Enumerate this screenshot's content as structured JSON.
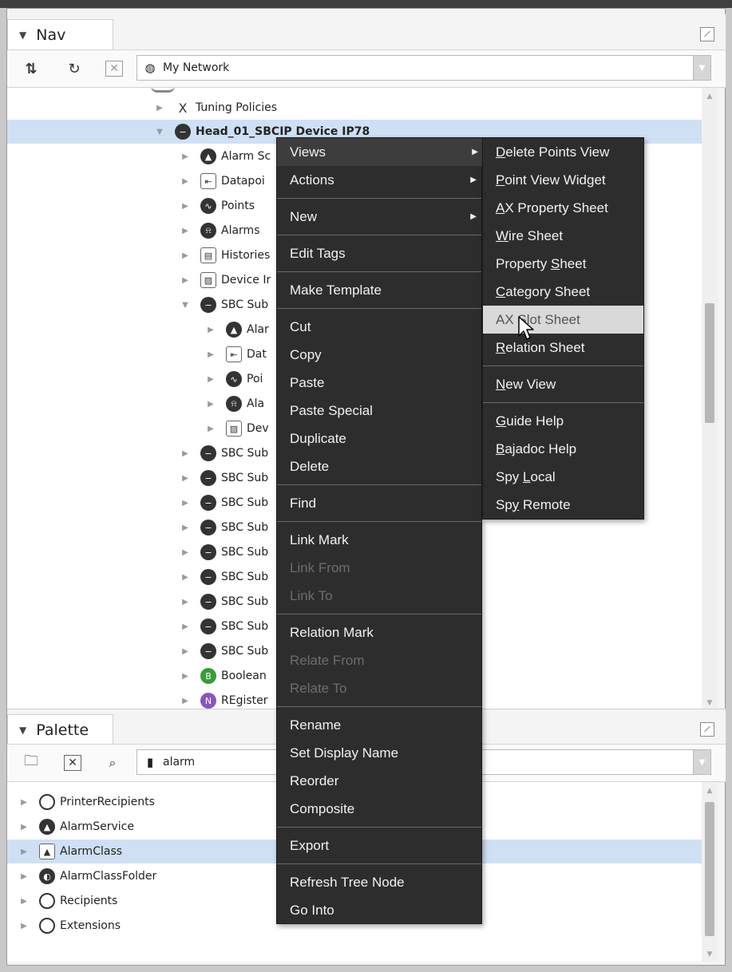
{
  "nav": {
    "title": "Nav",
    "combo_value": "My Network",
    "tree": [
      {
        "label": "Tuning Policies",
        "icon": "tuning-icon",
        "glyph": "X"
      },
      {
        "label": "Head_01_SBCIP Device  IP78",
        "icon": "device-icon",
        "glyph": "−",
        "selected": true,
        "bold": true
      },
      {
        "label": "Alarm Sc",
        "icon": "alarm-source-icon",
        "glyph": "▲"
      },
      {
        "label": "Datapoi",
        "icon": "datapoint-icon",
        "glyph": "⇤"
      },
      {
        "label": "Points",
        "icon": "points-icon",
        "glyph": "∿"
      },
      {
        "label": "Alarms",
        "icon": "alarm-bell-icon",
        "glyph": "⍾"
      },
      {
        "label": "Histories",
        "icon": "histories-icon",
        "glyph": "▤"
      },
      {
        "label": "Device Ir",
        "icon": "device-info-icon",
        "glyph": "▨"
      },
      {
        "label": "SBC Sub",
        "icon": "sbc-sub-icon",
        "glyph": "−"
      },
      {
        "label": "Alar",
        "icon": "alarm-source-icon",
        "glyph": "▲"
      },
      {
        "label": "Dat",
        "icon": "datapoint-icon",
        "glyph": "⇤"
      },
      {
        "label": "Poi",
        "icon": "points-icon",
        "glyph": "∿"
      },
      {
        "label": "Ala",
        "icon": "alarm-bell-icon",
        "glyph": "⍾"
      },
      {
        "label": "Dev",
        "icon": "device-info-icon",
        "glyph": "▨"
      },
      {
        "label": "SBC Sub",
        "icon": "sbc-sub-icon",
        "glyph": "−"
      },
      {
        "label": "SBC Sub",
        "icon": "sbc-sub-icon",
        "glyph": "−"
      },
      {
        "label": "SBC Sub",
        "icon": "sbc-sub-icon",
        "glyph": "−"
      },
      {
        "label": "SBC Sub",
        "icon": "sbc-sub-icon",
        "glyph": "−"
      },
      {
        "label": "SBC Sub",
        "icon": "sbc-sub-icon",
        "glyph": "−"
      },
      {
        "label": "SBC Sub",
        "icon": "sbc-sub-icon",
        "glyph": "−"
      },
      {
        "label": "SBC Sub",
        "icon": "sbc-sub-icon",
        "glyph": "−"
      },
      {
        "label": "SBC Sub",
        "icon": "sbc-sub-icon",
        "glyph": "−"
      },
      {
        "label": "SBC Sub",
        "icon": "sbc-sub-icon",
        "glyph": "−"
      },
      {
        "label": "Boolean",
        "icon": "boolean-icon",
        "glyph": "B"
      },
      {
        "label": "REgister",
        "icon": "numeric-icon",
        "glyph": "N"
      }
    ]
  },
  "palette": {
    "title": "Palette",
    "combo_value": "alarm",
    "tree": [
      {
        "label": "PrinterRecipients",
        "icon": "recipient-icon"
      },
      {
        "label": "AlarmService",
        "icon": "alarm-service-icon"
      },
      {
        "label": "AlarmClass",
        "icon": "alarm-class-icon",
        "selected": true
      },
      {
        "label": "AlarmClassFolder",
        "icon": "alarm-class-folder-icon"
      },
      {
        "label": "Recipients",
        "icon": "recipient-icon"
      },
      {
        "label": "Extensions",
        "icon": "extension-icon"
      }
    ]
  },
  "context_menu": {
    "items": [
      {
        "label": "Views",
        "submenu": true,
        "highlighted": true
      },
      {
        "label": "Actions",
        "submenu": true
      },
      {
        "label": "New",
        "submenu": true
      },
      {
        "label": "Edit Tags"
      },
      {
        "label": "Make Template"
      },
      {
        "label": "Cut"
      },
      {
        "label": "Copy"
      },
      {
        "label": "Paste"
      },
      {
        "label": "Paste Special"
      },
      {
        "label": "Duplicate"
      },
      {
        "label": "Delete"
      },
      {
        "label": "Find"
      },
      {
        "label": "Link Mark"
      },
      {
        "label": "Link From",
        "disabled": true
      },
      {
        "label": "Link To",
        "disabled": true
      },
      {
        "label": "Relation Mark"
      },
      {
        "label": "Relate From",
        "disabled": true
      },
      {
        "label": "Relate To",
        "disabled": true
      },
      {
        "label": "Rename"
      },
      {
        "label": "Set Display Name"
      },
      {
        "label": "Reorder"
      },
      {
        "label": "Composite"
      },
      {
        "label": "Export"
      },
      {
        "label": "Refresh Tree Node"
      },
      {
        "label": "Go Into"
      }
    ]
  },
  "views_submenu": {
    "items": [
      {
        "label": "Delete Points View",
        "mnemonic": "D"
      },
      {
        "label": "Point View Widget",
        "mnemonic": "P"
      },
      {
        "label": "AX Property Sheet",
        "mnemonic": "A"
      },
      {
        "label": "Wire Sheet",
        "mnemonic": "W"
      },
      {
        "label": "Property Sheet",
        "mnemonic": "S"
      },
      {
        "label": "Category Sheet",
        "mnemonic": "C"
      },
      {
        "label": "AX Slot Sheet",
        "highlighted": true
      },
      {
        "label": "Relation Sheet",
        "mnemonic": "R"
      },
      {
        "label": "New View",
        "mnemonic": "N"
      },
      {
        "label": "Guide Help",
        "mnemonic": "G"
      },
      {
        "label": "Bajadoc Help",
        "mnemonic": "B"
      },
      {
        "label": "Spy Local",
        "mnemonic": "L"
      },
      {
        "label": "Spy Remote",
        "mnemonic": "y"
      }
    ]
  },
  "colors": {
    "menu_bg": "#2d2d2d",
    "menu_highlight": "#d9d9d9",
    "tree_selection": "#cfe0f5",
    "disabled_text": "#6d6d6d"
  }
}
